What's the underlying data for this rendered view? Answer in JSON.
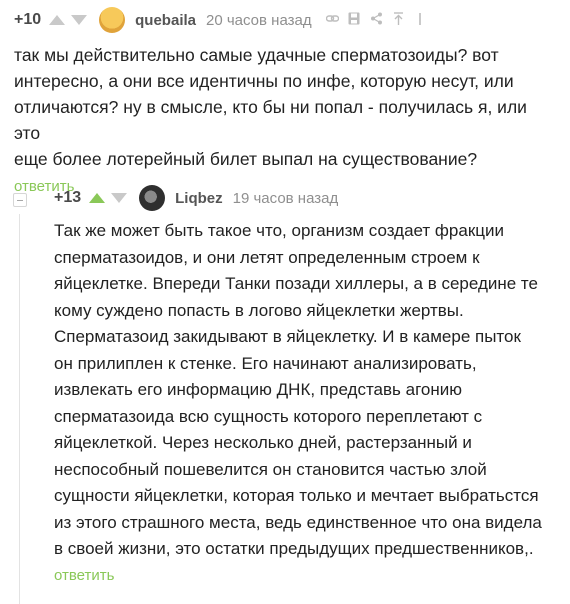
{
  "comments": [
    {
      "rating": "+10",
      "author": "quebaila",
      "time": "20 часов назад",
      "text": "так мы действительно самые удачные сперматозоиды? вот\nинтересно, а они все идентичны по инфе, которую несут, или\nотличаются? ну в смысле, кто бы ни попал - получилась я, или это\nеще более лотерейный билет выпал на существование?",
      "reply_label": "ответить",
      "upvote_color": "#c9c9c9"
    },
    {
      "rating": "+13",
      "author": "Liqbez",
      "time": "19 часов назад",
      "text": "Так же может быть такое что, организм создает фракции\nсперматазоидов, и они летят определенным строем к\nяйцеклетке. Впереди Танки позади хиллеры, а в середине те\nкому суждено попасть в логово яйцеклетки жертвы.\nСперматазоид закидывают в яйцеклетку. И в камере пыток\nон прилиплен к стенке. Его начинают анализировать,\nизвлекать его информацию ДНК, представь агонию\nсперматазоида всю сущность которого переплетают с\nяйцеклеткой. Через несколько дней, растерзанный и\nнеспособный пошевелится он становится частью злой\nсущности яйцеклетки, которая только и мечтает выбратьстся\nиз этого страшного места, ведь единственное что она видела\nв своей жизни, это остатки предыдущих предшественников,.",
      "reply_label": "ответить",
      "upvote_color": "#8ac858"
    }
  ],
  "icons": {
    "link": "link-icon",
    "save": "save-icon",
    "share": "share-icon",
    "parent": "go-to-parent-icon"
  },
  "colors": {
    "accent_green": "#8ac858",
    "muted_gray": "#8f8f8f",
    "text": "#222222"
  }
}
